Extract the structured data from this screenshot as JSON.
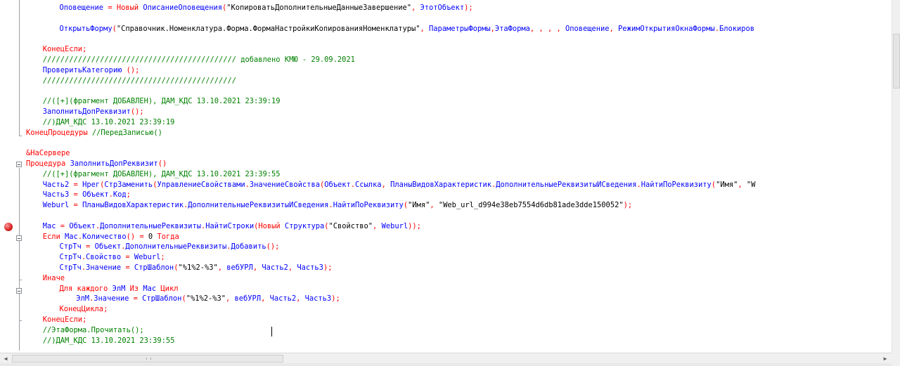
{
  "editor": {
    "lines": [
      {
        "indent": 8,
        "tokens": [
          {
            "t": "Оповещение",
            "c": "df"
          },
          {
            "t": " = ",
            "c": "pn"
          },
          {
            "t": "Новый",
            "c": "kw"
          },
          {
            "t": " ОписаниеОповещения",
            "c": "df"
          },
          {
            "t": "(",
            "c": "pn"
          },
          {
            "t": "\"КопироватьДополнительныеДанныеЗавершение\"",
            "c": "st"
          },
          {
            "t": ", ",
            "c": "pn"
          },
          {
            "t": "ЭтотОбъект",
            "c": "df"
          },
          {
            "t": ");",
            "c": "pn"
          }
        ]
      },
      {
        "indent": 0,
        "tokens": []
      },
      {
        "indent": 8,
        "tokens": [
          {
            "t": "ОткрытьФорму",
            "c": "df"
          },
          {
            "t": "(",
            "c": "pn"
          },
          {
            "t": "\"Справочник.Номенклатура.Форма.ФормаНастройкиКопированияНоменклатуры\"",
            "c": "st"
          },
          {
            "t": ", ",
            "c": "pn"
          },
          {
            "t": "ПараметрыФормы",
            "c": "df"
          },
          {
            "t": ",",
            "c": "pn"
          },
          {
            "t": "ЭтаФорма",
            "c": "df"
          },
          {
            "t": ", , , , ",
            "c": "pn"
          },
          {
            "t": "Оповещение",
            "c": "df"
          },
          {
            "t": ", ",
            "c": "pn"
          },
          {
            "t": "РежимОткрытияОкнаФормы",
            "c": "df"
          },
          {
            "t": ".",
            "c": "pn"
          },
          {
            "t": "Блокиров",
            "c": "df"
          }
        ]
      },
      {
        "indent": 0,
        "tokens": []
      },
      {
        "indent": 4,
        "tokens": [
          {
            "t": "КонецЕсли",
            "c": "kw"
          },
          {
            "t": ";",
            "c": "pn"
          }
        ]
      },
      {
        "indent": 4,
        "tokens": [
          {
            "t": "//////////////////////////////////////////// добавлено КМЮ - 29.09.2021",
            "c": "cm"
          }
        ]
      },
      {
        "indent": 4,
        "tokens": [
          {
            "t": "ПроверитьКатегорию",
            "c": "df"
          },
          {
            "t": " ();",
            "c": "pn"
          }
        ]
      },
      {
        "indent": 4,
        "tokens": [
          {
            "t": "////////////////////////////////////////////",
            "c": "cm"
          }
        ]
      },
      {
        "indent": 0,
        "tokens": []
      },
      {
        "indent": 4,
        "tokens": [
          {
            "t": "//([+](фрагмент ДОБАВЛЕН), ДАМ_КДС 13.10.2021 23:39:19",
            "c": "cm"
          }
        ]
      },
      {
        "indent": 4,
        "tokens": [
          {
            "t": "ЗаполнитьДопРеквизит",
            "c": "df"
          },
          {
            "t": "();",
            "c": "pn"
          }
        ]
      },
      {
        "indent": 4,
        "tokens": [
          {
            "t": "//)ДАМ_КДС 13.10.2021 23:39:19",
            "c": "cm"
          }
        ]
      },
      {
        "indent": 0,
        "tokens": [
          {
            "t": "КонецПроцедуры",
            "c": "kw"
          },
          {
            "t": " //ПередЗаписью()",
            "c": "cm"
          }
        ]
      },
      {
        "indent": 0,
        "tokens": []
      },
      {
        "indent": 0,
        "tokens": [
          {
            "t": "&НаСервере",
            "c": "kw"
          }
        ]
      },
      {
        "indent": 0,
        "tokens": [
          {
            "t": "Процедура",
            "c": "kw"
          },
          {
            "t": " ЗаполнитьДопРеквизит",
            "c": "df"
          },
          {
            "t": "()",
            "c": "pn"
          }
        ]
      },
      {
        "indent": 4,
        "tokens": [
          {
            "t": "//([+](фрагмент ДОБАВЛЕН), ДАМ_КДС 13.10.2021 23:39:55",
            "c": "cm"
          }
        ]
      },
      {
        "indent": 4,
        "tokens": [
          {
            "t": "Часть2",
            "c": "df"
          },
          {
            "t": " = ",
            "c": "pn"
          },
          {
            "t": "Нрег",
            "c": "df"
          },
          {
            "t": "(",
            "c": "pn"
          },
          {
            "t": "СтрЗаменить",
            "c": "df"
          },
          {
            "t": "(",
            "c": "pn"
          },
          {
            "t": "УправлениеСвойствами",
            "c": "df"
          },
          {
            "t": ".",
            "c": "pn"
          },
          {
            "t": "ЗначениеСвойства",
            "c": "df"
          },
          {
            "t": "(",
            "c": "pn"
          },
          {
            "t": "Объект",
            "c": "df"
          },
          {
            "t": ".",
            "c": "pn"
          },
          {
            "t": "Ссылка",
            "c": "df"
          },
          {
            "t": ", ",
            "c": "pn"
          },
          {
            "t": "ПланыВидовХарактеристик",
            "c": "df"
          },
          {
            "t": ".",
            "c": "pn"
          },
          {
            "t": "ДополнительныеРеквизитыИСведения",
            "c": "df"
          },
          {
            "t": ".",
            "c": "pn"
          },
          {
            "t": "НайтиПоРеквизиту",
            "c": "df"
          },
          {
            "t": "(",
            "c": "pn"
          },
          {
            "t": "\"Имя\"",
            "c": "st"
          },
          {
            "t": ", ",
            "c": "pn"
          },
          {
            "t": "\"W",
            "c": "st"
          }
        ]
      },
      {
        "indent": 4,
        "tokens": [
          {
            "t": "Часть3",
            "c": "df"
          },
          {
            "t": " = ",
            "c": "pn"
          },
          {
            "t": "Объект",
            "c": "df"
          },
          {
            "t": ".",
            "c": "pn"
          },
          {
            "t": "Код",
            "c": "df"
          },
          {
            "t": ";",
            "c": "pn"
          }
        ]
      },
      {
        "indent": 4,
        "tokens": [
          {
            "t": "Weburl",
            "c": "df"
          },
          {
            "t": " = ",
            "c": "pn"
          },
          {
            "t": "ПланыВидовХарактеристик",
            "c": "df"
          },
          {
            "t": ".",
            "c": "pn"
          },
          {
            "t": "ДополнительныеРеквизитыИСведения",
            "c": "df"
          },
          {
            "t": ".",
            "c": "pn"
          },
          {
            "t": "НайтиПоРеквизиту",
            "c": "df"
          },
          {
            "t": "(",
            "c": "pn"
          },
          {
            "t": "\"Имя\"",
            "c": "st"
          },
          {
            "t": ", ",
            "c": "pn"
          },
          {
            "t": "\"Web_url_d994e38eb7554d6db81ade3dde150052\"",
            "c": "st"
          },
          {
            "t": ");",
            "c": "pn"
          }
        ]
      },
      {
        "indent": 0,
        "tokens": []
      },
      {
        "indent": 4,
        "tokens": [
          {
            "t": "Мас",
            "c": "df"
          },
          {
            "t": " = ",
            "c": "pn"
          },
          {
            "t": "Объект",
            "c": "df"
          },
          {
            "t": ".",
            "c": "pn"
          },
          {
            "t": "ДополнительныеРеквизиты",
            "c": "df"
          },
          {
            "t": ".",
            "c": "pn"
          },
          {
            "t": "НайтиСтроки",
            "c": "df"
          },
          {
            "t": "(",
            "c": "pn"
          },
          {
            "t": "Новый",
            "c": "kw"
          },
          {
            "t": " Структура",
            "c": "df"
          },
          {
            "t": "(",
            "c": "pn"
          },
          {
            "t": "\"Свойство\"",
            "c": "st"
          },
          {
            "t": ", ",
            "c": "pn"
          },
          {
            "t": "Weburl",
            "c": "df"
          },
          {
            "t": "));",
            "c": "pn"
          }
        ]
      },
      {
        "indent": 4,
        "tokens": [
          {
            "t": "Если",
            "c": "kw"
          },
          {
            "t": " Мас",
            "c": "df"
          },
          {
            "t": ".",
            "c": "pn"
          },
          {
            "t": "Количество",
            "c": "df"
          },
          {
            "t": "() = ",
            "c": "pn"
          },
          {
            "t": "0",
            "c": "st"
          },
          {
            "t": " Тогда",
            "c": "kw"
          }
        ]
      },
      {
        "indent": 8,
        "tokens": [
          {
            "t": "СтрТч",
            "c": "df"
          },
          {
            "t": " = ",
            "c": "pn"
          },
          {
            "t": "Объект",
            "c": "df"
          },
          {
            "t": ".",
            "c": "pn"
          },
          {
            "t": "ДополнительныеРеквизиты",
            "c": "df"
          },
          {
            "t": ".",
            "c": "pn"
          },
          {
            "t": "Добавить",
            "c": "df"
          },
          {
            "t": "();",
            "c": "pn"
          }
        ]
      },
      {
        "indent": 8,
        "tokens": [
          {
            "t": "СтрТч",
            "c": "df"
          },
          {
            "t": ".",
            "c": "pn"
          },
          {
            "t": "Свойство",
            "c": "df"
          },
          {
            "t": " = ",
            "c": "pn"
          },
          {
            "t": "Weburl",
            "c": "df"
          },
          {
            "t": ";",
            "c": "pn"
          }
        ]
      },
      {
        "indent": 8,
        "tokens": [
          {
            "t": "СтрТч",
            "c": "df"
          },
          {
            "t": ".",
            "c": "pn"
          },
          {
            "t": "Значение",
            "c": "df"
          },
          {
            "t": " = ",
            "c": "pn"
          },
          {
            "t": "СтрШаблон",
            "c": "df"
          },
          {
            "t": "(",
            "c": "pn"
          },
          {
            "t": "\"%1%2-%3\"",
            "c": "st"
          },
          {
            "t": ", ",
            "c": "pn"
          },
          {
            "t": "вебУРЛ",
            "c": "df"
          },
          {
            "t": ", ",
            "c": "pn"
          },
          {
            "t": "Часть2",
            "c": "df"
          },
          {
            "t": ", ",
            "c": "pn"
          },
          {
            "t": "Часть3",
            "c": "df"
          },
          {
            "t": ");",
            "c": "pn"
          }
        ]
      },
      {
        "indent": 4,
        "tokens": [
          {
            "t": "Иначе",
            "c": "kw"
          }
        ]
      },
      {
        "indent": 8,
        "tokens": [
          {
            "t": "Для каждого",
            "c": "kw"
          },
          {
            "t": " ЭлМ",
            "c": "df"
          },
          {
            "t": " Из",
            "c": "kw"
          },
          {
            "t": " Мас",
            "c": "df"
          },
          {
            "t": " Цикл",
            "c": "kw"
          }
        ]
      },
      {
        "indent": 12,
        "tokens": [
          {
            "t": "ЭлМ",
            "c": "df"
          },
          {
            "t": ".",
            "c": "pn"
          },
          {
            "t": "Значение",
            "c": "df"
          },
          {
            "t": " = ",
            "c": "pn"
          },
          {
            "t": "СтрШаблон",
            "c": "df"
          },
          {
            "t": "(",
            "c": "pn"
          },
          {
            "t": "\"%1%2-%3\"",
            "c": "st"
          },
          {
            "t": ", ",
            "c": "pn"
          },
          {
            "t": "вебУРЛ",
            "c": "df"
          },
          {
            "t": ", ",
            "c": "pn"
          },
          {
            "t": "Часть2",
            "c": "df"
          },
          {
            "t": ", ",
            "c": "pn"
          },
          {
            "t": "Часть3",
            "c": "df"
          },
          {
            "t": ");",
            "c": "pn"
          }
        ]
      },
      {
        "indent": 8,
        "tokens": [
          {
            "t": "КонецЦикла",
            "c": "kw"
          },
          {
            "t": ";",
            "c": "pn"
          }
        ]
      },
      {
        "indent": 4,
        "tokens": [
          {
            "t": "КонецЕсли",
            "c": "kw"
          },
          {
            "t": ";",
            "c": "pn"
          }
        ]
      },
      {
        "indent": 4,
        "tokens": [
          {
            "t": "//ЭтаФорма.Прочитать();",
            "c": "cm"
          }
        ]
      },
      {
        "indent": 4,
        "tokens": [
          {
            "t": "//)ДАМ_КДС 13.10.2021 23:39:55",
            "c": "cm"
          }
        ]
      }
    ]
  },
  "icons": {
    "breakpoint": "breakpoint-icon",
    "fold": "fold-collapse-icon",
    "scroll_left": "scroll-left-arrow-icon",
    "scroll_right": "scroll-right-arrow-icon"
  },
  "scroll": {
    "left_arrow": "◀",
    "right_arrow": "▶"
  }
}
